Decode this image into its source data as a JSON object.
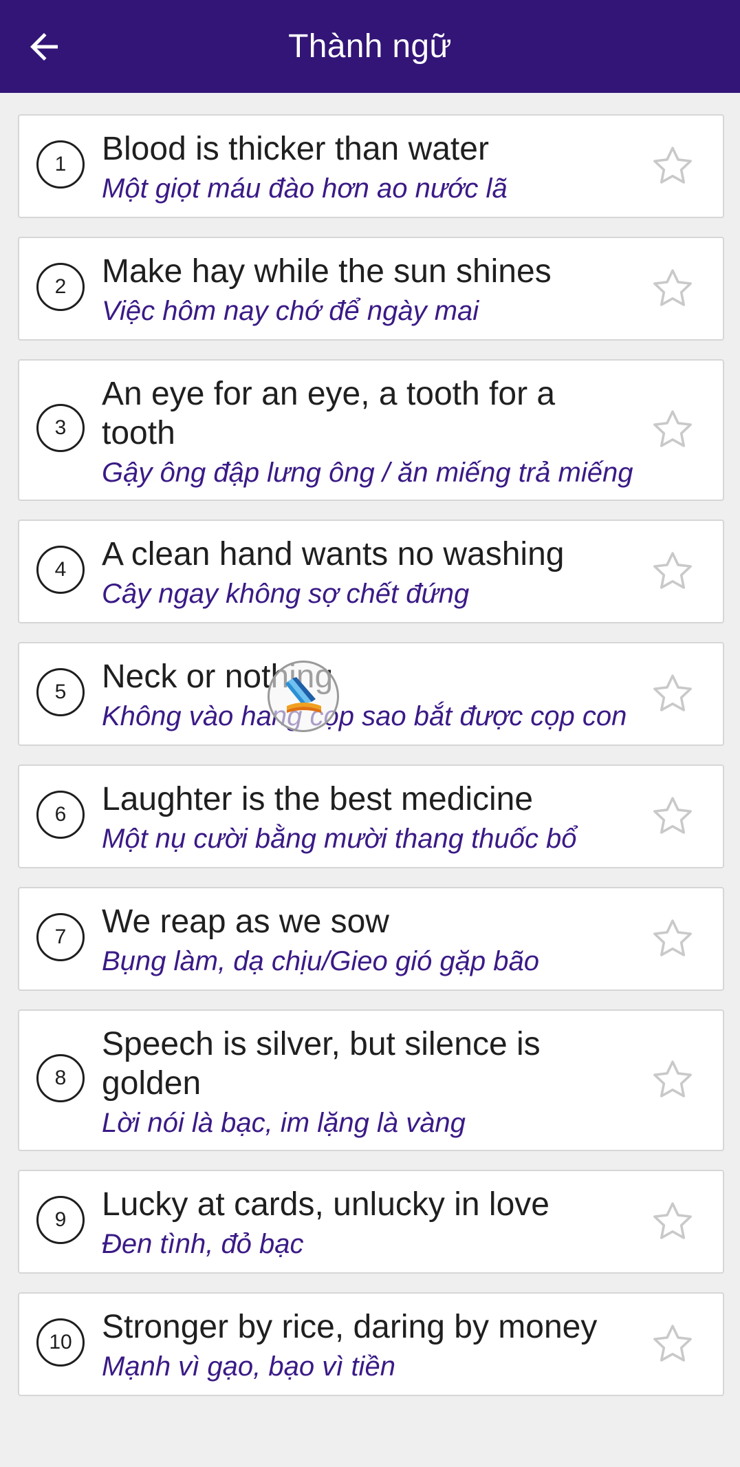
{
  "header": {
    "title": "Thành ngữ",
    "back_icon": "arrow-left-icon",
    "background": "#331577"
  },
  "items": [
    {
      "number": "1",
      "english": "Blood is thicker than water",
      "vietnamese": "Một giọt máu đào hơn ao nước lã",
      "favorite": false
    },
    {
      "number": "2",
      "english": "Make hay while the sun shines",
      "vietnamese": "Việc hôm nay chớ để ngày mai",
      "favorite": false
    },
    {
      "number": "3",
      "english": "An eye for an eye, a tooth for a tooth",
      "vietnamese": "Gậy ông đập lưng ông / ăn miếng trả miếng",
      "favorite": false
    },
    {
      "number": "4",
      "english": "A clean hand wants no washing",
      "vietnamese": "Cây ngay không sợ chết đứng",
      "favorite": false
    },
    {
      "number": "5",
      "english": "Neck or nothing",
      "vietnamese": "Không vào hang cọp sao bắt được cọp con",
      "favorite": false
    },
    {
      "number": "6",
      "english": "Laughter is the best medicine",
      "vietnamese": "Một nụ cười bằng mười thang thuốc bổ",
      "favorite": false
    },
    {
      "number": "7",
      "english": "We reap as we sow",
      "vietnamese": "Bụng làm, dạ chịu/Gieo gió gặp bão",
      "favorite": false
    },
    {
      "number": "8",
      "english": "Speech is silver, but silence is golden",
      "vietnamese": "Lời nói là bạc, im lặng là vàng",
      "favorite": false
    },
    {
      "number": "9",
      "english": "Lucky at cards, unlucky in love",
      "vietnamese": "Đen tình, đỏ bạc",
      "favorite": false
    },
    {
      "number": "10",
      "english": "Stronger by rice, daring by money",
      "vietnamese": "Mạnh vì gạo, bạo vì tiền",
      "favorite": false
    }
  ],
  "floating_button": {
    "icon": "book-logo-icon"
  },
  "colors": {
    "accent": "#331577",
    "translation_text": "#3a1a86",
    "star_outline": "#c9c9c9"
  }
}
